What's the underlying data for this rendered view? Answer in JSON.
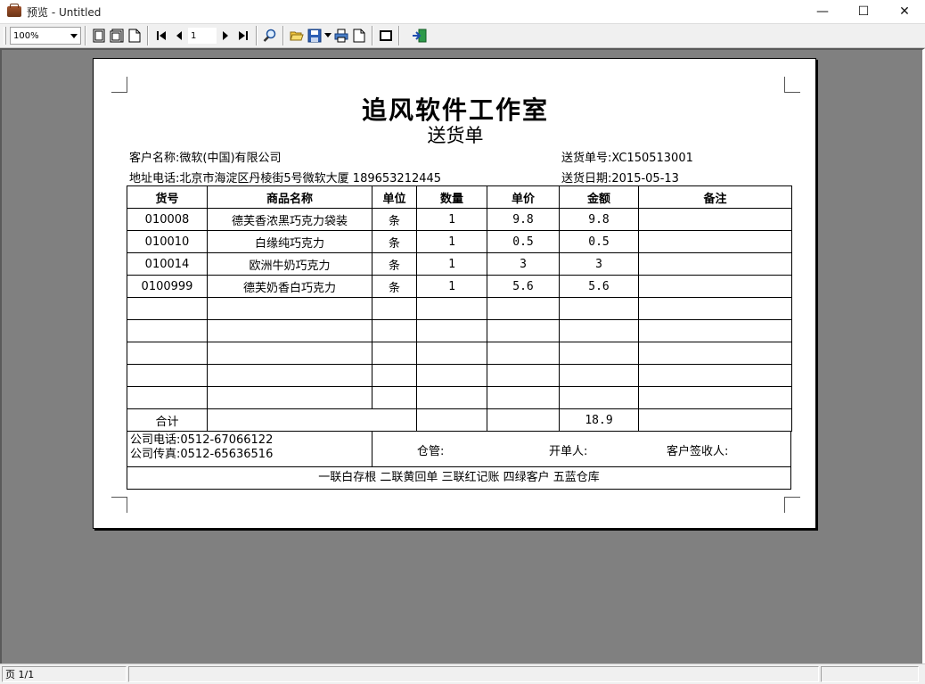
{
  "window": {
    "title": "预览 - Untitled",
    "controls": {
      "minimize": "—",
      "maximize": "☐",
      "close": "✕"
    }
  },
  "toolbar": {
    "zoom": "100%",
    "page_number": "1"
  },
  "document": {
    "company": "追风软件工作室",
    "doc_type": "送货单",
    "customer_label": "客户名称:",
    "customer": "微软(中国)有限公司",
    "order_no_label": "送货单号:",
    "order_no": "XC150513001",
    "address_label": "地址电话:",
    "address": "北京市海淀区丹棱街5号微软大厦 189653212445",
    "date_label": "送货日期:",
    "date": "2015-05-13",
    "columns": [
      "货号",
      "商品名称",
      "单位",
      "数量",
      "单价",
      "金额",
      "备注"
    ],
    "rows": [
      [
        "010008",
        "德芙香浓黑巧克力袋装",
        "条",
        "1",
        "9.8",
        "9.8",
        ""
      ],
      [
        "010010",
        "白缘纯巧克力",
        "条",
        "1",
        "0.5",
        "0.5",
        ""
      ],
      [
        "010014",
        "欧洲牛奶巧克力",
        "条",
        "1",
        "3",
        "3",
        ""
      ],
      [
        "0100999",
        "德芙奶香白巧克力",
        "条",
        "1",
        "5.6",
        "5.6",
        ""
      ],
      [
        "",
        "",
        "",
        "",
        "",
        "",
        ""
      ],
      [
        "",
        "",
        "",
        "",
        "",
        "",
        ""
      ],
      [
        "",
        "",
        "",
        "",
        "",
        "",
        ""
      ],
      [
        "",
        "",
        "",
        "",
        "",
        "",
        ""
      ],
      [
        "",
        "",
        "",
        "",
        "",
        "",
        ""
      ]
    ],
    "total_label": "合计",
    "total": "18.9",
    "phone_label": "公司电话:",
    "phone": "0512-67066122",
    "fax_label": "公司传真:",
    "fax": "0512-65636516",
    "warehouse_label": "仓管:",
    "issuer_label": "开单人:",
    "receiver_label": "客户签收人:",
    "copies": "一联白存根 二联黄回单 三联红记账 四绿客户 五蓝仓库"
  },
  "status": {
    "page_info": "页 1/1"
  }
}
